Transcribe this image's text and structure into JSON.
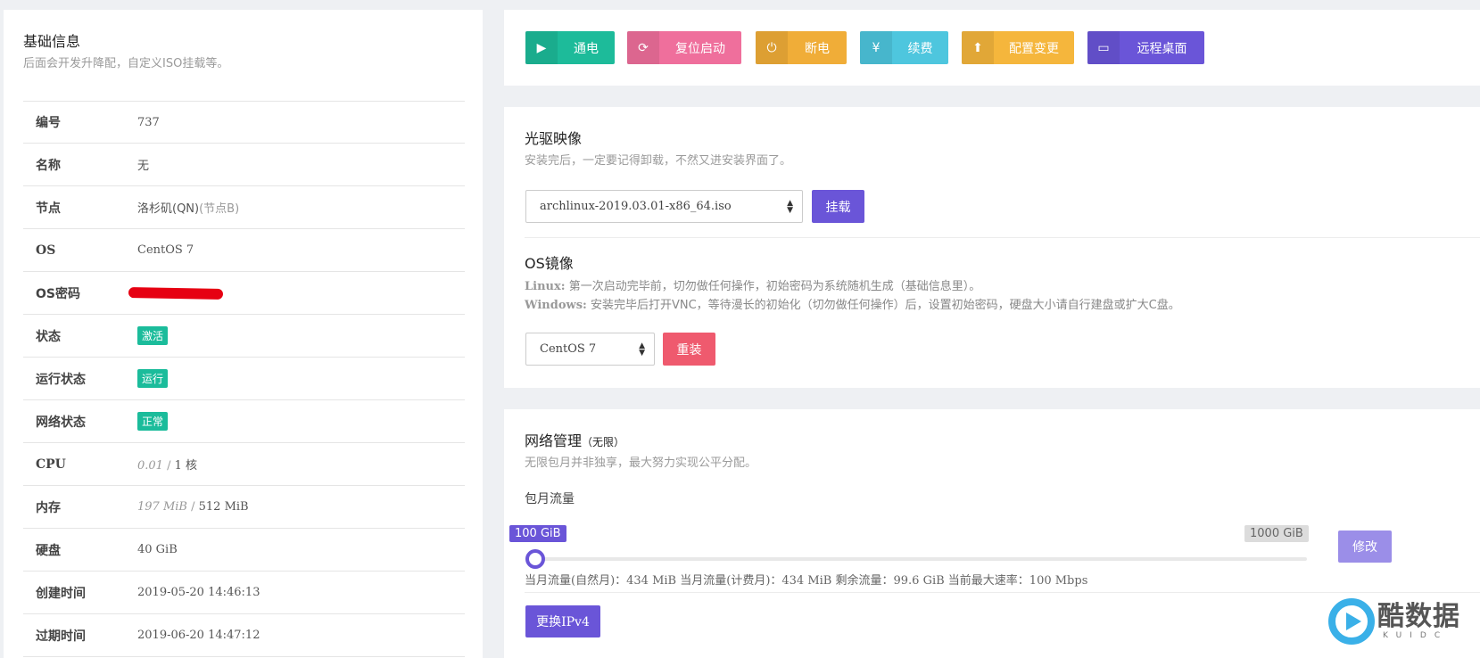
{
  "basic_info": {
    "title": "基础信息",
    "subtitle": "后面会开发升降配，自定义ISO挂载等。",
    "rows": [
      {
        "key": "编号",
        "value": "737"
      },
      {
        "key": "名称",
        "value": "无"
      },
      {
        "key": "节点",
        "value": "洛杉矶(QN)",
        "extra": "(节点B)"
      },
      {
        "key": "OS",
        "value": "CentOS 7"
      },
      {
        "key": "OS密码",
        "value": ""
      },
      {
        "key": "状态",
        "badge": "激活"
      },
      {
        "key": "运行状态",
        "badge": "运行"
      },
      {
        "key": "网络状态",
        "badge": "正常"
      },
      {
        "key": "CPU",
        "used": "0.01",
        "sep": "/",
        "total": "1 核"
      },
      {
        "key": "内存",
        "used": "197 MiB",
        "sep": "/",
        "total": "512 MiB"
      },
      {
        "key": "硬盘",
        "value": "40 GiB"
      },
      {
        "key": "创建时间",
        "value": "2019-05-20 14:46:13"
      },
      {
        "key": "过期时间",
        "value": "2019-06-20 14:47:12"
      }
    ]
  },
  "actions": [
    {
      "label": "通电",
      "icon": "play-icon",
      "glyph": "▶",
      "color": "#1dbb9a"
    },
    {
      "label": "复位启动",
      "icon": "refresh-icon",
      "glyph": "⟳",
      "color": "#ef6f9c"
    },
    {
      "label": "断电",
      "icon": "power-icon",
      "glyph": "⏻",
      "color": "#f0ad38"
    },
    {
      "label": "续费",
      "icon": "yen-icon",
      "glyph": "¥",
      "color": "#4ec6de"
    },
    {
      "label": "配置变更",
      "icon": "upload-arrow-icon",
      "glyph": "⬆",
      "color": "#f5b63c"
    },
    {
      "label": "远程桌面",
      "icon": "monitor-icon",
      "glyph": "▭",
      "color": "#6a55d8"
    }
  ],
  "iso": {
    "title": "光驱映像",
    "subtitle": "安装完后，一定要记得卸载，不然又进安装界面了。",
    "selected": "archlinux-2019.03.01-x86_64.iso",
    "mount_label": "挂载"
  },
  "os_image": {
    "title": "OS镜像",
    "linux_label": "Linux:",
    "linux_note": "第一次启动完毕前，切勿做任何操作，初始密码为系统随机生成（基础信息里）。",
    "windows_label": "Windows:",
    "windows_note": "安装完毕后打开VNC，等待漫长的初始化（切勿做任何操作）后，设置初始密码，硬盘大小请自行建盘或扩大C盘。",
    "selected": "CentOS 7",
    "reinstall_label": "重装"
  },
  "network": {
    "title": "网络管理",
    "title_suffix": "（无限）",
    "subtitle": "无限包月并非独享，最大努力实现公平分配。",
    "traffic_label": "包月流量",
    "slider_current": "100 GiB",
    "slider_max": "1000 GiB",
    "slider_fraction": 0.0,
    "modify_label": "修改",
    "usage_text": "当月流量(自然月)：434 MiB  当月流量(计费月)：434 MiB  剩余流量：99.6 GiB  当前最大速率：100 Mbps",
    "change_ipv4_label": "更换IPv4"
  },
  "watermark": {
    "text": "酷数据",
    "sub": "KUIDC"
  },
  "colors": {
    "accent": "#6a55d8",
    "badge_green": "#1bbc9b",
    "reinstall_red": "#ef5a6e"
  }
}
